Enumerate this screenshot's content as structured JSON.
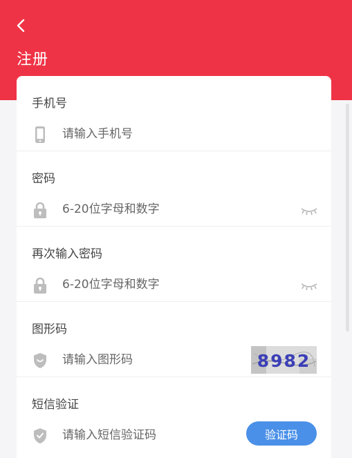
{
  "header": {
    "title": "注册"
  },
  "form": {
    "phone": {
      "label": "手机号",
      "placeholder": "请输入手机号"
    },
    "password": {
      "label": "密码",
      "placeholder": "6-20位字母和数字"
    },
    "confirm_password": {
      "label": "再次输入密码",
      "placeholder": "6-20位字母和数字"
    },
    "captcha": {
      "label": "图形码",
      "placeholder": "请输入图形码",
      "image_text": "8982"
    },
    "sms": {
      "label": "短信验证",
      "placeholder": "请输入短信验证码",
      "button_label": "验证码"
    }
  },
  "colors": {
    "brand": "#ef3346",
    "accent": "#4a90e8",
    "icon": "#bdbdbd"
  }
}
